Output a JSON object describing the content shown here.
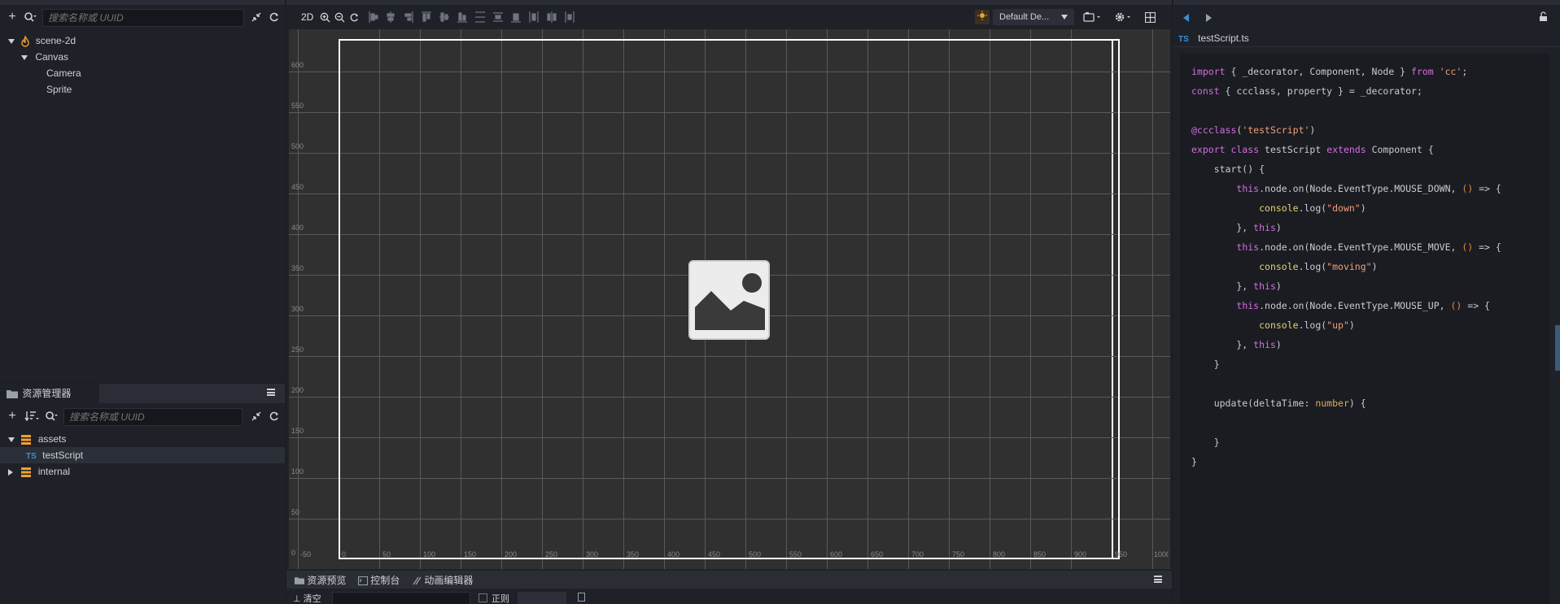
{
  "hierarchy": {
    "search_placeholder": "搜索名称或 UUID",
    "nodes": [
      {
        "label": "scene-2d"
      },
      {
        "label": "Canvas"
      },
      {
        "label": "Camera"
      },
      {
        "label": "Sprite"
      }
    ]
  },
  "assets": {
    "title": "资源管理器",
    "search_placeholder": "搜索名称或 UUID",
    "nodes": [
      {
        "label": "assets"
      },
      {
        "label": "testScript",
        "badge": "TS"
      },
      {
        "label": "internal"
      }
    ]
  },
  "scene": {
    "toolbar": {
      "mode_2d": "2D",
      "device_select": "Default De..."
    },
    "y_ticks": [
      "600",
      "550",
      "500",
      "450",
      "400",
      "350",
      "300",
      "250",
      "200",
      "150",
      "100",
      "50",
      "0"
    ],
    "x_ticks": [
      "-50",
      "0",
      "50",
      "100",
      "150",
      "200",
      "250",
      "300",
      "350",
      "400",
      "450",
      "500",
      "550",
      "600",
      "650",
      "700",
      "750",
      "800",
      "850",
      "900",
      "950",
      "1000"
    ]
  },
  "bottom_tabs": [
    {
      "label": "资源预览"
    },
    {
      "label": "控制台"
    },
    {
      "label": "动画编辑器"
    }
  ],
  "bottom_bar": {
    "clear_label": "清空",
    "check_label": "正则"
  },
  "editor": {
    "file_badge": "TS",
    "file_name": "testScript.ts",
    "code_lines": [
      "import { _decorator, Component, Node } from 'cc';",
      "const { ccclass, property } = _decorator;",
      "",
      "@ccclass('testScript')",
      "export class testScript extends Component {",
      "    start() {",
      "        this.node.on(Node.EventType.MOUSE_DOWN, () => {",
      "            console.log(\"down\")",
      "        }, this)",
      "        this.node.on(Node.EventType.MOUSE_MOVE, () => {",
      "            console.log(\"moving\")",
      "        }, this)",
      "        this.node.on(Node.EventType.MOUSE_UP, () => {",
      "            console.log(\"up\")",
      "        }, this)",
      "    }",
      "",
      "    update(deltaTime: number) {",
      "",
      "    }",
      "}"
    ]
  }
}
